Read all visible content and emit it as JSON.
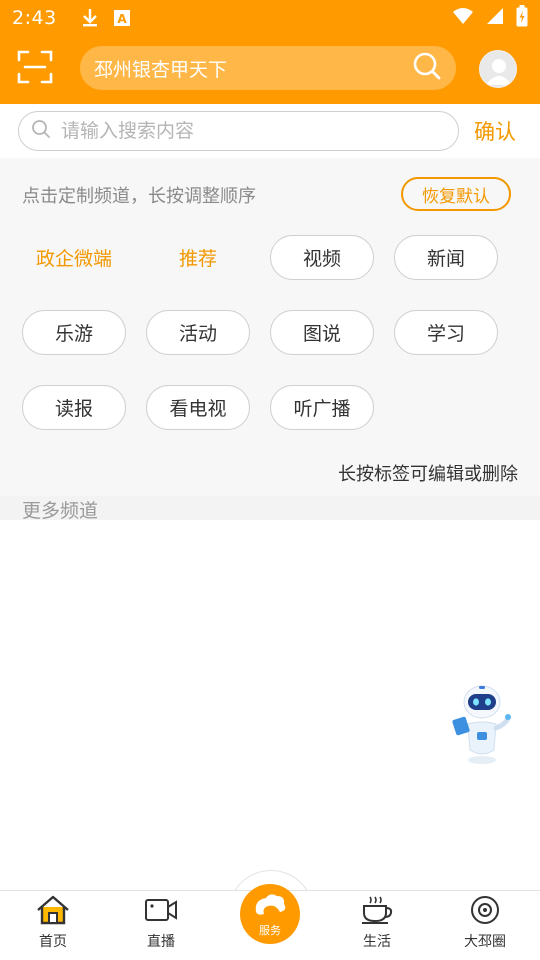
{
  "status_bar": {
    "time": "2:43",
    "icons": [
      "download-icon",
      "a-notification-icon",
      "wifi-icon",
      "signal-icon",
      "battery-icon"
    ]
  },
  "header": {
    "scan_icon": "scan-icon",
    "search_text": "邳州银杏甲天下",
    "search_icon": "search-icon",
    "avatar_icon": "user-avatar-icon"
  },
  "search": {
    "placeholder": "请输入搜索内容",
    "value": "",
    "confirm_label": "确认"
  },
  "channels": {
    "hint": "点击定制频道，长按调整顺序",
    "restore_label": "恢复默认",
    "items": [
      {
        "label": "政企微端",
        "active": true
      },
      {
        "label": "推荐",
        "active": true
      },
      {
        "label": "视频",
        "active": false
      },
      {
        "label": "新闻",
        "active": false
      },
      {
        "label": "乐游",
        "active": false
      },
      {
        "label": "活动",
        "active": false
      },
      {
        "label": "图说",
        "active": false
      },
      {
        "label": "学习",
        "active": false
      },
      {
        "label": "读报",
        "active": false
      },
      {
        "label": "看电视",
        "active": false
      },
      {
        "label": "听广播",
        "active": false
      }
    ],
    "edit_hint": "长按标签可编辑或删除",
    "more_label": "更多频道"
  },
  "bottom_nav": {
    "items": [
      {
        "label": "首页",
        "icon": "home-icon"
      },
      {
        "label": "直播",
        "icon": "video-camera-icon"
      },
      {
        "label": "服务",
        "icon": "service-logo-icon"
      },
      {
        "label": "生活",
        "icon": "coffee-cup-icon"
      },
      {
        "label": "大邳圈",
        "icon": "target-circle-icon"
      }
    ]
  },
  "colors": {
    "brand_orange": "#FF9B00",
    "accent_text": "#F39800",
    "panel_bg": "#f7f7f7"
  }
}
